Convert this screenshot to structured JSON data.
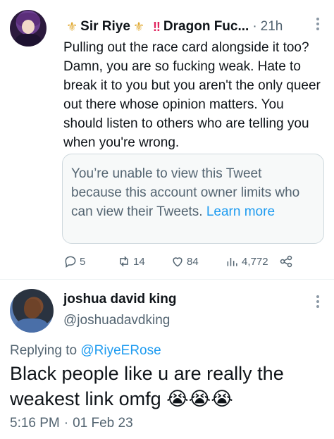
{
  "tweet1": {
    "display_name": "Sir Riye",
    "crown_emoji": "⚜",
    "bang_emoji": "‼",
    "display_name_suffix": "Dragon Fuc...",
    "separator": "·",
    "time": "21h",
    "text": "Pulling out the race card alongside it too? Damn, you are so fucking weak. Hate to break it to you but you aren't the only queer out there whose opinion matters. You should listen to others who are telling you when you're wrong.",
    "quote": {
      "text": "You’re unable to view this Tweet because this account owner limits who can view their Tweets.",
      "link": "Learn more"
    },
    "actions": {
      "replies": "5",
      "retweets": "14",
      "likes": "84",
      "views": "4,772"
    },
    "icons": [
      "reply-icon",
      "retweet-icon",
      "like-icon",
      "views-icon",
      "share-icon",
      "more-icon"
    ]
  },
  "tweet2": {
    "display_name": "joshua david king",
    "handle": "@joshuadavdking",
    "replying_label": "Replying to",
    "replying_to": "@RiyeERose",
    "text": "Black people like u are really the weakest link omfg",
    "emoji": "😭😭😭",
    "time": "5:16 PM",
    "separator": "·",
    "date": "01 Feb 23"
  },
  "colors": {
    "text": "#0f1419",
    "secondary": "#536471",
    "link": "#1d9bf0",
    "border": "#cfd9de"
  }
}
